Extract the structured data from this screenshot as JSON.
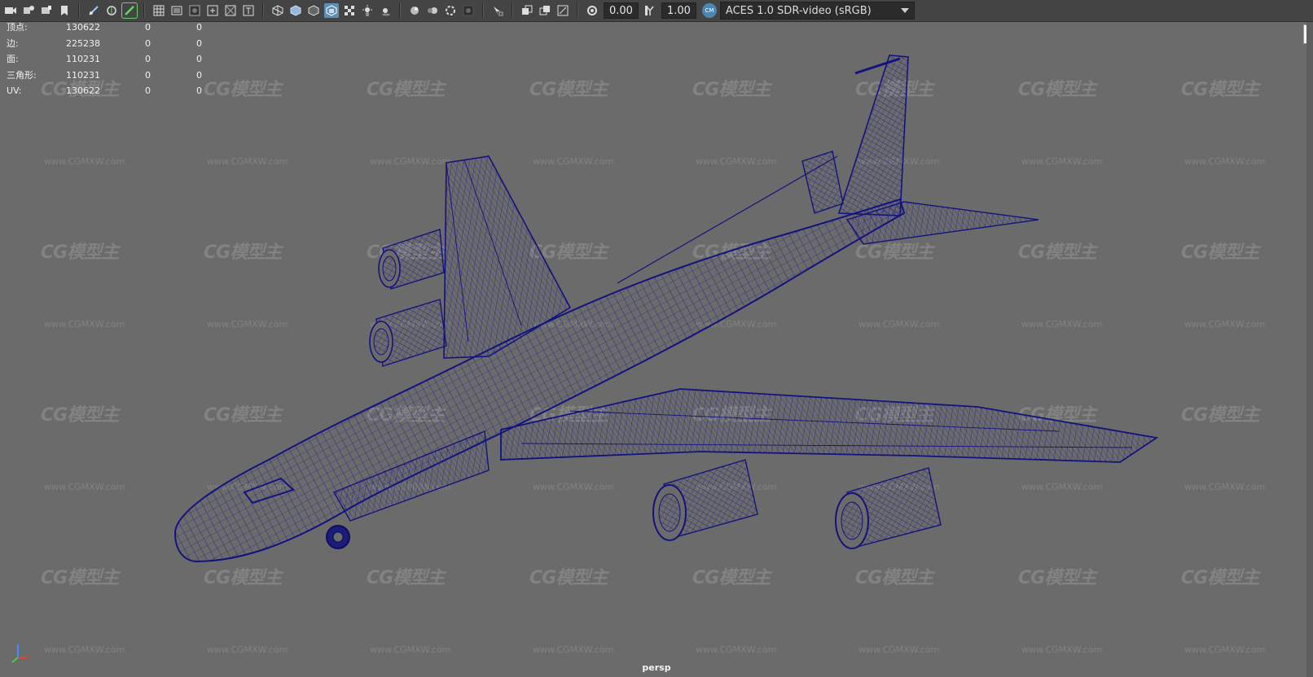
{
  "toolbar": {
    "exposure_value": "0.00",
    "gamma_value": "1.00",
    "colorspace_badge": "CM",
    "colorspace": "ACES 1.0 SDR-video (sRGB)"
  },
  "stats": {
    "rows": [
      {
        "label": "顶点:",
        "v1": "130622",
        "v2": "0",
        "v3": "0"
      },
      {
        "label": "边:",
        "v1": "225238",
        "v2": "0",
        "v3": "0"
      },
      {
        "label": "面:",
        "v1": "110231",
        "v2": "0",
        "v3": "0"
      },
      {
        "label": "三角形:",
        "v1": "110231",
        "v2": "0",
        "v3": "0"
      },
      {
        "label": "UV:",
        "v1": "130622",
        "v2": "0",
        "v3": "0"
      }
    ]
  },
  "viewport": {
    "camera": "persp",
    "background": "#6b6b6b",
    "wire_color": "#16168c"
  },
  "watermark": {
    "logo_text": "CG模型主",
    "url_text": "www.CGMXW.com"
  }
}
